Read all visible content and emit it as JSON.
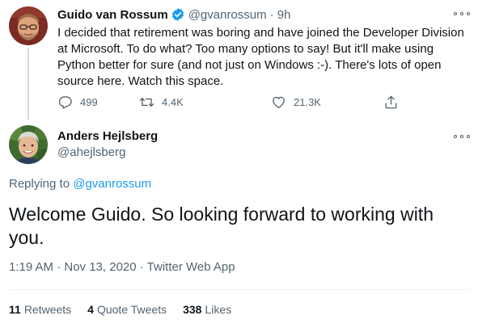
{
  "colors": {
    "accent": "#1d9bf0",
    "text_primary": "#0f1419",
    "text_secondary": "#536471"
  },
  "tweet1": {
    "author_name": "Guido van Rossum",
    "verified_icon": "verified-badge-icon",
    "handle": "@gvanrossum",
    "time": "· 9h",
    "text": "I decided that retirement was boring and have joined the Developer Division at Microsoft. To do what? Too many options to say! But it'll make using Python better for sure (and not just on Windows :-). There's lots of open source here. Watch this space.",
    "actions": {
      "reply_icon": "reply-icon",
      "reply_count": "499",
      "retweet_icon": "retweet-icon",
      "retweet_count": "4.4K",
      "like_icon": "heart-icon",
      "like_count": "21.3K",
      "share_icon": "share-icon"
    }
  },
  "tweet2": {
    "author_name": "Anders Hejlsberg",
    "handle": "@ahejlsberg",
    "replying_prefix": "Replying to",
    "replying_to": "@gvanrossum",
    "text": "Welcome Guido. So looking forward to working with you.",
    "meta": "1:19 AM · Nov 13, 2020 · Twitter Web App",
    "stats": {
      "retweets_count": "11",
      "retweets_label": "Retweets",
      "quotes_count": "4",
      "quotes_label": "Quote Tweets",
      "likes_count": "338",
      "likes_label": "Likes"
    }
  }
}
